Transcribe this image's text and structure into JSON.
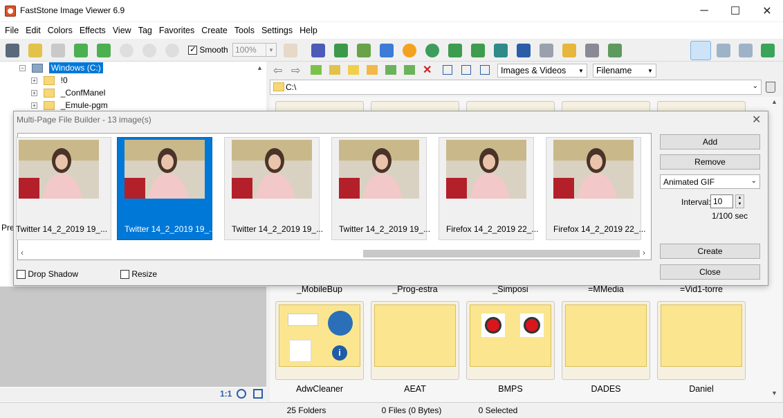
{
  "window": {
    "title": "FastStone Image Viewer 6.9"
  },
  "menu": [
    "File",
    "Edit",
    "Colors",
    "Effects",
    "View",
    "Tag",
    "Favorites",
    "Create",
    "Tools",
    "Settings",
    "Help"
  ],
  "toolbar": {
    "smooth_label": "Smooth",
    "smooth_checked": true,
    "zoom_value": "100%"
  },
  "tree": {
    "drive": "Windows (C:)",
    "items": [
      "!0",
      "_ConfManel",
      "_Emule-pgm"
    ]
  },
  "left_pane": {
    "partial_label": "Pre",
    "ratio_label": "1:1"
  },
  "browser": {
    "filter_value": "Images & Videos",
    "sort_value": "Filename",
    "path": "C:\\",
    "folders_row1": [
      "_MobileBup",
      "_Prog-estra",
      "_Simposi",
      "=MMedia",
      "=Vid1-torre"
    ],
    "folders_row2": [
      "AdwCleaner",
      "AEAT",
      "BMPS",
      "DADES",
      "Daniel"
    ]
  },
  "status": {
    "folders": "25 Folders",
    "files": "0 Files (0 Bytes)",
    "selected": "0 Selected"
  },
  "dialog": {
    "title": "Multi-Page File Builder  -  13 image(s)",
    "frames": [
      {
        "caption": "Twitter 14_2_2019 19_...",
        "selected": false
      },
      {
        "caption": "Twitter 14_2_2019 19_...",
        "selected": true
      },
      {
        "caption": "Twitter 14_2_2019 19_...",
        "selected": false
      },
      {
        "caption": "Twitter 14_2_2019 19_...",
        "selected": false
      },
      {
        "caption": "Firefox 14_2_2019 22_...",
        "selected": false
      },
      {
        "caption": "Firefox 14_2_2019 22_...",
        "selected": false
      }
    ],
    "add_label": "Add",
    "remove_label": "Remove",
    "format_value": "Animated GIF",
    "interval_label": "Interval:",
    "interval_value": "10",
    "interval_unit": "1/100 sec",
    "create_label": "Create",
    "close_label": "Close",
    "drop_shadow_label": "Drop Shadow",
    "resize_label": "Resize"
  },
  "colors": {
    "selection": "#0078d7",
    "folder_fill": "#fbe68f"
  }
}
